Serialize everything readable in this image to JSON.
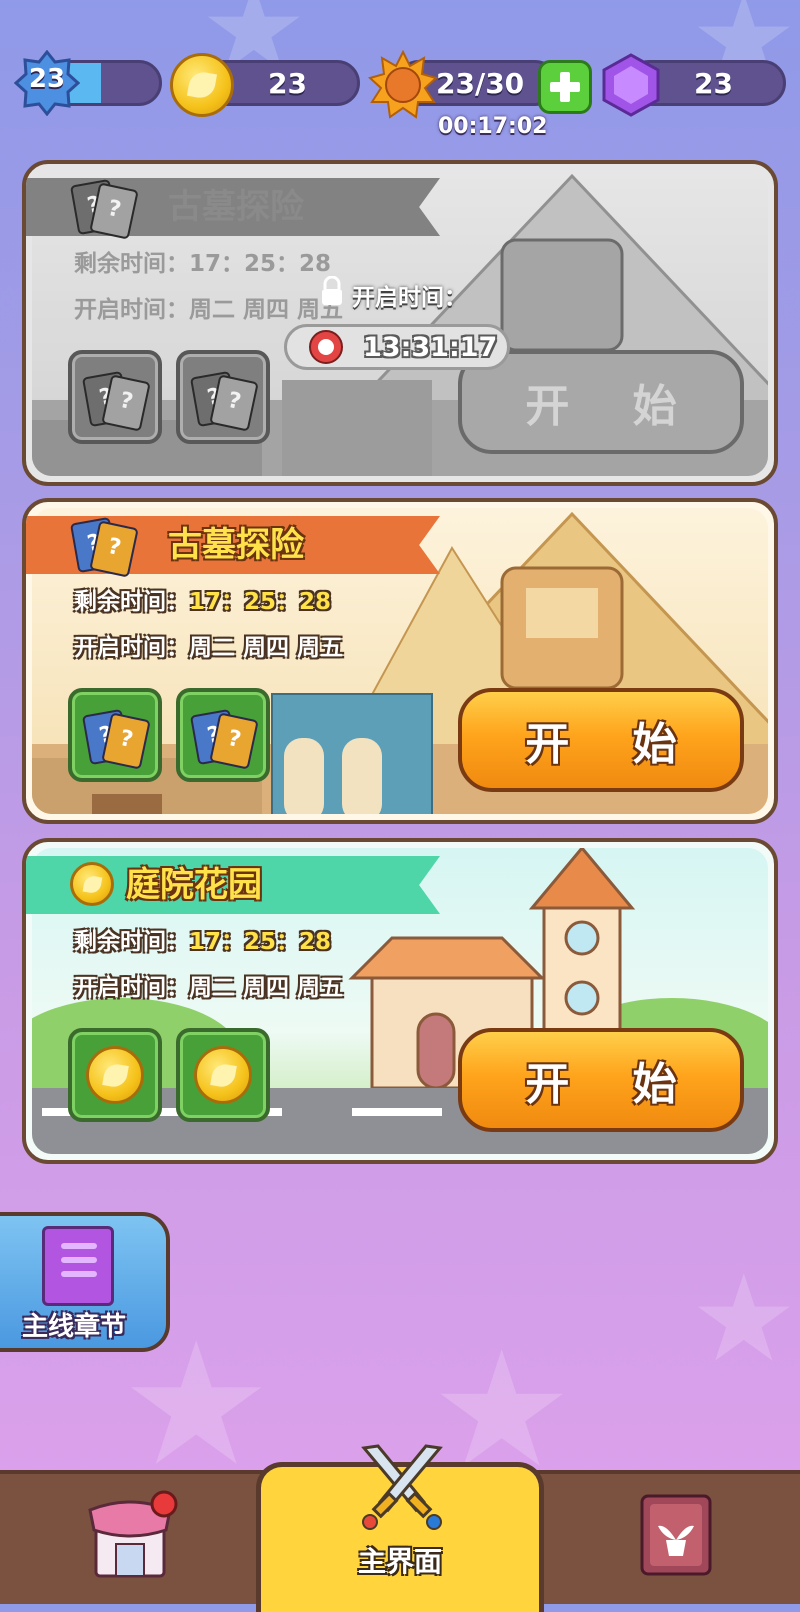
{
  "header": {
    "level": "23",
    "level_progress": 0.5,
    "coins": "23",
    "energy": "23/30",
    "energy_timer": "00:17:02",
    "gems": "23"
  },
  "cards": [
    {
      "title": "古墓探险",
      "remaining_label": "剩余时间：",
      "remaining_value": "17：25：28",
      "open_label": "开启时间：",
      "open_value": "周二 周四 周五",
      "start_label": "开 始",
      "locked": true,
      "lock_label": "开启时间：",
      "lock_countdown": "13:31:17"
    },
    {
      "title": "古墓探险",
      "remaining_label": "剩余时间：",
      "remaining_value": "17：25：28",
      "open_label": "开启时间：",
      "open_value": "周二 周四 周五",
      "start_label": "开 始",
      "locked": false
    },
    {
      "title": "庭院花园",
      "remaining_label": "剩余时间：",
      "remaining_value": "17：25：28",
      "open_label": "开启时间：",
      "open_value": "周二 周四 周五",
      "start_label": "开 始",
      "locked": false
    }
  ],
  "side_button": {
    "label": "主线章节"
  },
  "nav": {
    "center_label": "主界面"
  },
  "colors": {
    "ribbon_orange": "#e8743a",
    "ribbon_teal": "#4fd6a8",
    "button_orange": "#ffa41c"
  }
}
